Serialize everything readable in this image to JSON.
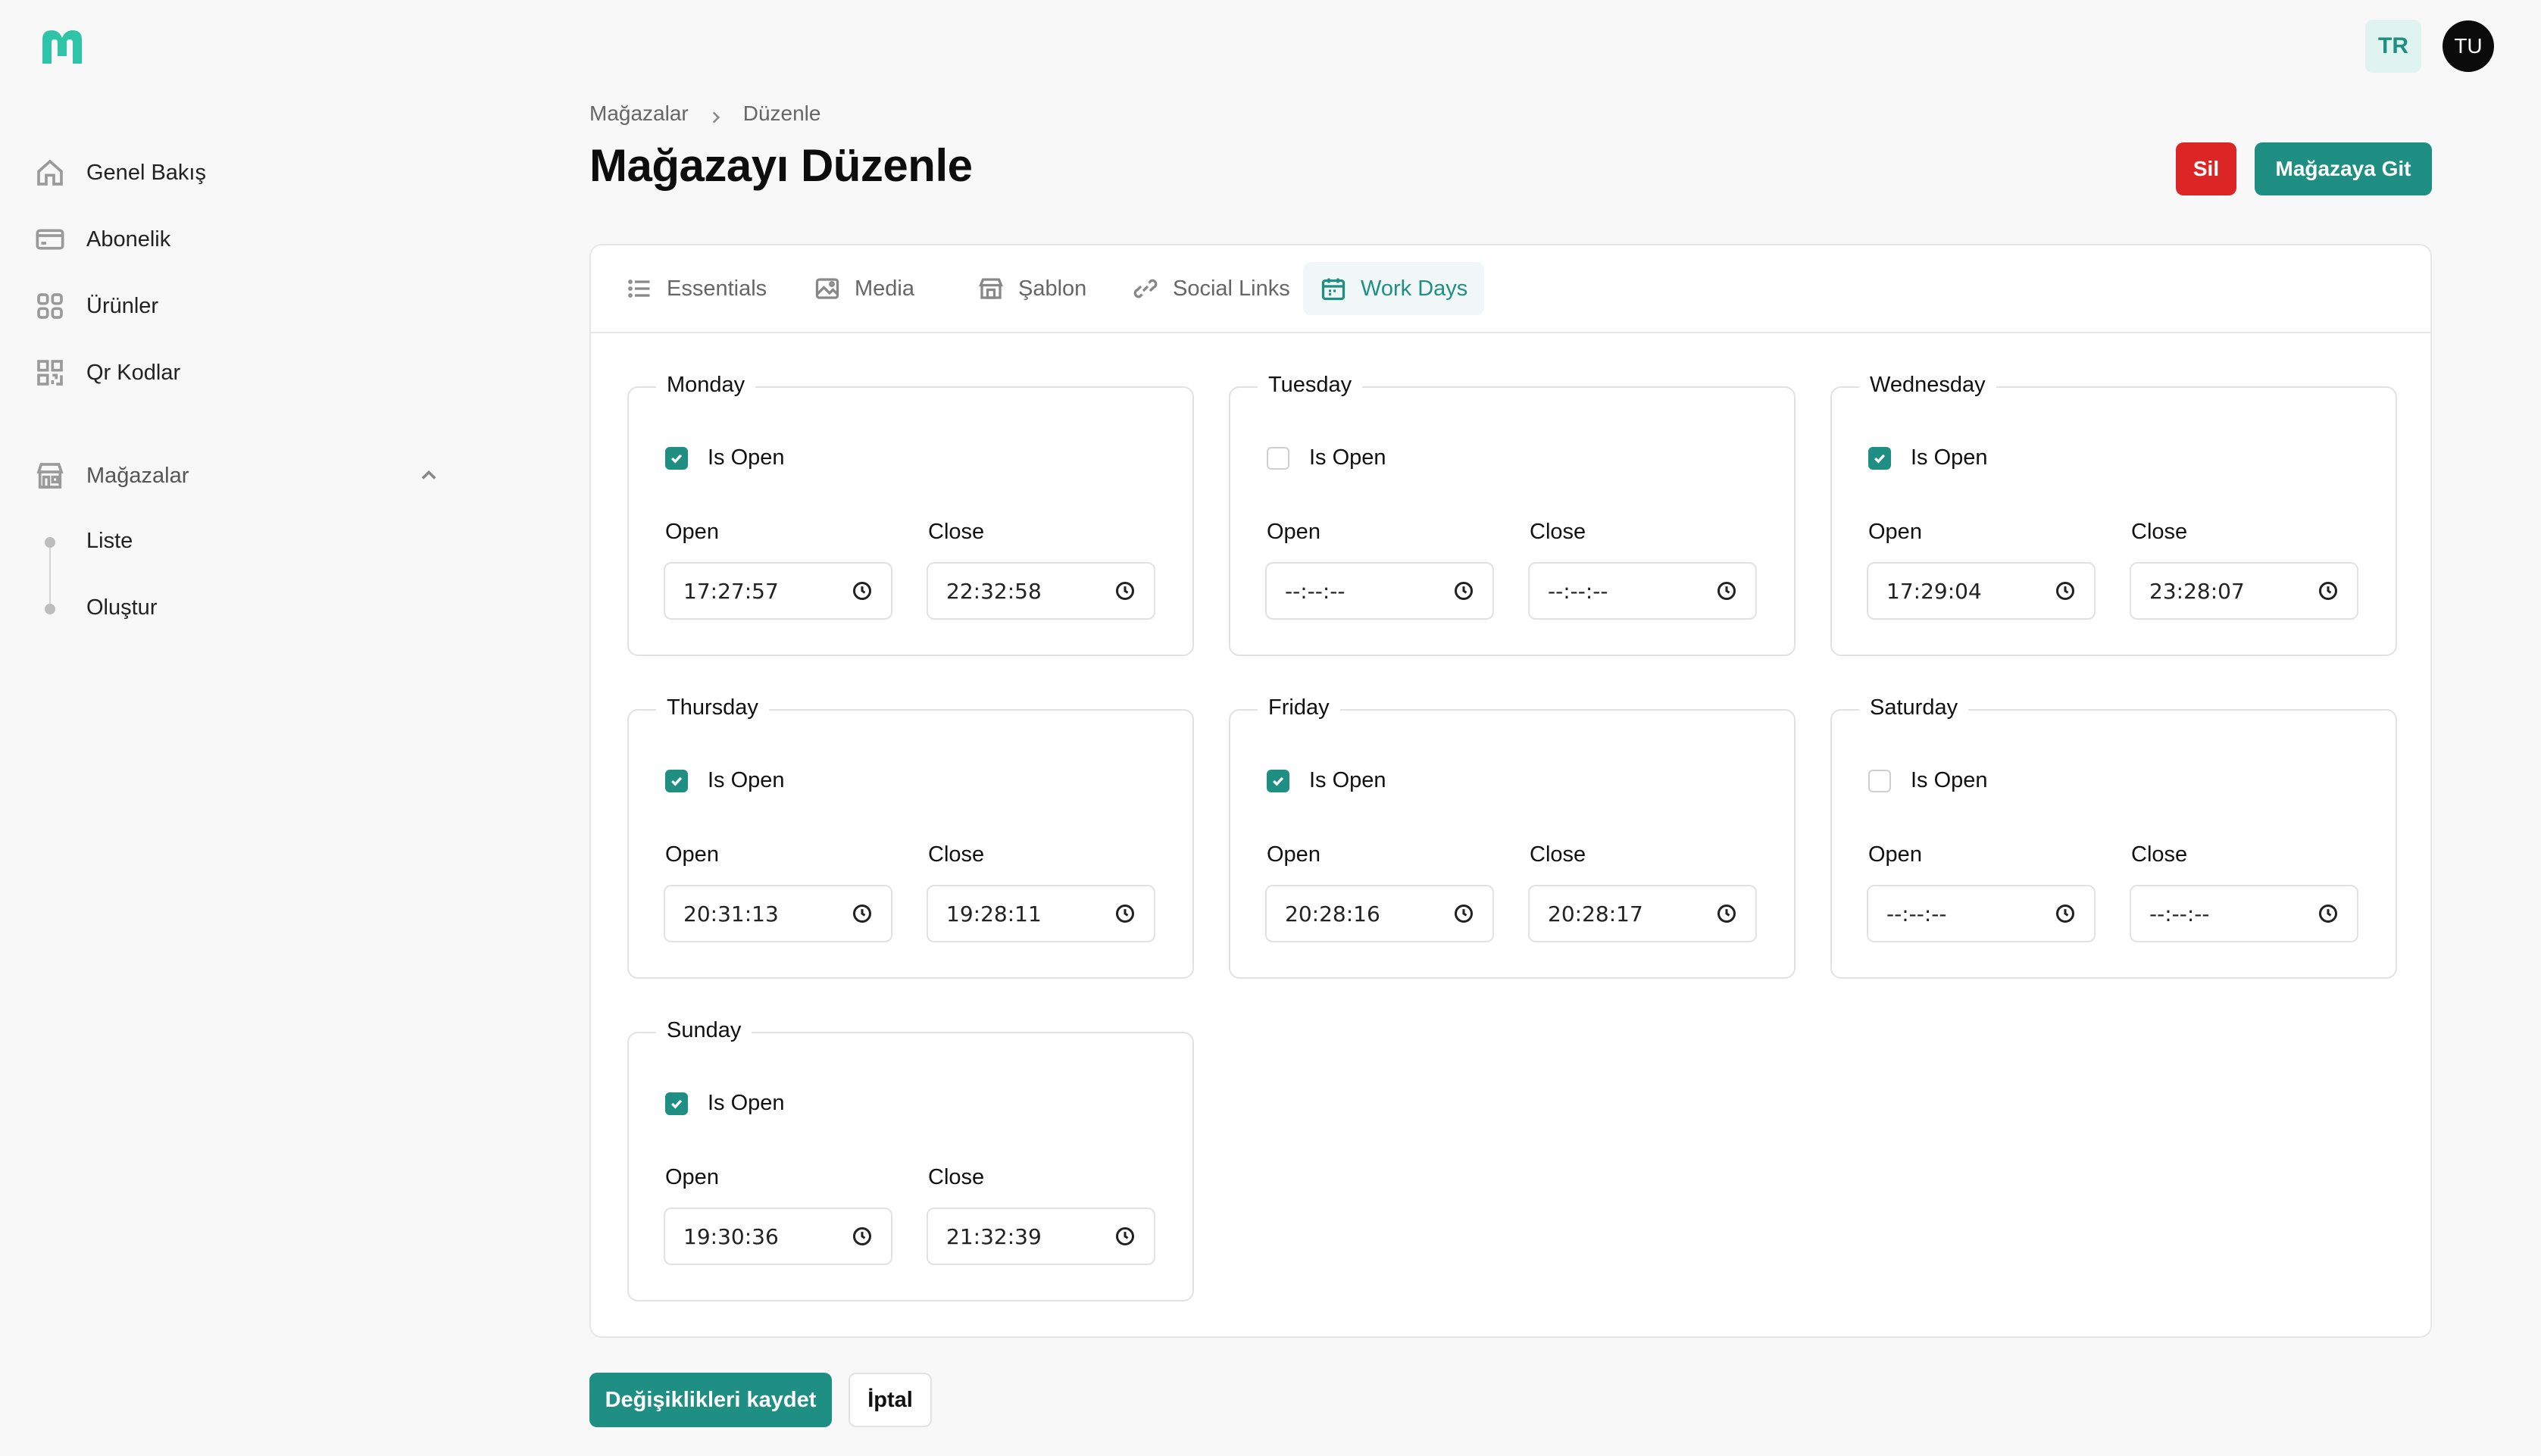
{
  "app": {
    "brand_color": "#1f8f83",
    "danger_color": "#dc2626",
    "language_badge": "TR",
    "user_initials": "TU"
  },
  "sidebar": {
    "items": [
      {
        "label": "Genel Bakış",
        "icon": "home-icon"
      },
      {
        "label": "Abonelik",
        "icon": "credit-card-icon"
      },
      {
        "label": "Ürünler",
        "icon": "grid-icon"
      },
      {
        "label": "Qr Kodlar",
        "icon": "qr-code-icon"
      }
    ],
    "group": {
      "label": "Mağazalar",
      "icon": "store-icon",
      "expanded": true,
      "children": [
        {
          "label": "Liste"
        },
        {
          "label": "Oluştur"
        }
      ]
    }
  },
  "breadcrumb": {
    "parent": "Mağazalar",
    "current": "Düzenle"
  },
  "page": {
    "title": "Mağazayı Düzenle",
    "delete_label": "Sil",
    "goto_label": "Mağazaya Git"
  },
  "tabs": [
    {
      "label": "Essentials",
      "icon": "list-icon"
    },
    {
      "label": "Media",
      "icon": "image-icon"
    },
    {
      "label": "Şablon",
      "icon": "storefront-icon"
    },
    {
      "label": "Social Links",
      "icon": "link-icon"
    },
    {
      "label": "Work Days",
      "icon": "calendar-icon",
      "active": true
    }
  ],
  "workdays": {
    "is_open_label": "Is Open",
    "open_label": "Open",
    "close_label": "Close",
    "days": [
      {
        "name": "Monday",
        "is_open": true,
        "open": "17:27:57",
        "close": "22:32:58"
      },
      {
        "name": "Tuesday",
        "is_open": false,
        "open": "--:--:--",
        "close": "--:--:--"
      },
      {
        "name": "Wednesday",
        "is_open": true,
        "open": "17:29:04",
        "close": "23:28:07"
      },
      {
        "name": "Thursday",
        "is_open": true,
        "open": "20:31:13",
        "close": "19:28:11"
      },
      {
        "name": "Friday",
        "is_open": true,
        "open": "20:28:16",
        "close": "20:28:17"
      },
      {
        "name": "Saturday",
        "is_open": false,
        "open": "--:--:--",
        "close": "--:--:--"
      },
      {
        "name": "Sunday",
        "is_open": true,
        "open": "19:30:36",
        "close": "21:32:39"
      }
    ]
  },
  "footer": {
    "save_label": "Değişiklikleri kaydet",
    "cancel_label": "İptal"
  }
}
